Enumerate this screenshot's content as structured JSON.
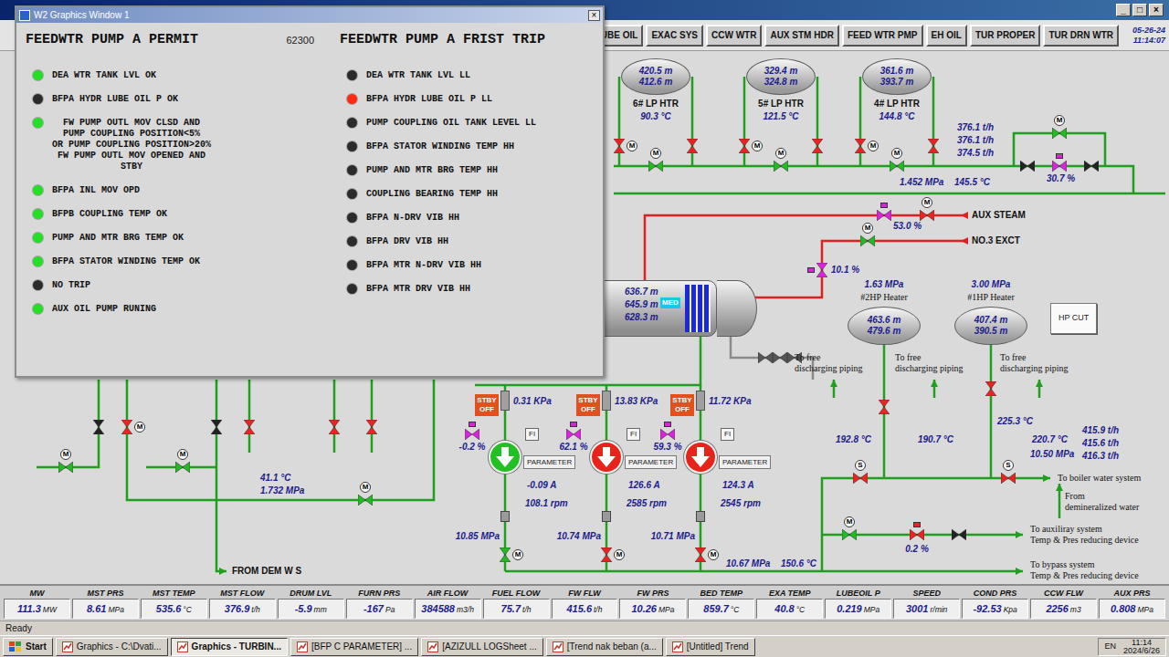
{
  "app_window": {
    "controls": [
      "_",
      "□",
      "×"
    ]
  },
  "tabs": [
    {
      "label": "LUBE OIL"
    },
    {
      "label": "EXAC SYS"
    },
    {
      "label": "CCW WTR"
    },
    {
      "label": "AUX STM HDR"
    },
    {
      "label": "FEED WTR PMP"
    },
    {
      "label": "EH OIL"
    },
    {
      "label": "TUR PROPER"
    },
    {
      "label": "TUR DRN WTR"
    }
  ],
  "clock": {
    "date": "05-26-24",
    "time": "11:14:07"
  },
  "diagram": {
    "symbols": {
      "motor": "M",
      "solenoid": "S"
    },
    "lp_heaters": [
      {
        "name": "6# LP HTR",
        "levels": [
          "420.5 m",
          "412.6 m"
        ],
        "temp": "90.3 °C"
      },
      {
        "name": "5# LP HTR",
        "levels": [
          "329.4 m",
          "324.8 m"
        ],
        "temp": "121.5 °C"
      },
      {
        "name": "4# LP HTR",
        "levels": [
          "361.6 m",
          "393.7 m"
        ],
        "temp": "144.8 °C"
      }
    ],
    "lp_line": {
      "flows": [
        "376.1 t/h",
        "376.1 t/h",
        "374.5 t/h"
      ],
      "pressure": "1.452 MPa",
      "temp": "145.5 °C",
      "bypass_valve": "30.7 %"
    },
    "steam": {
      "aux_label": "AUX STEAM",
      "aux_valve": "53.0 %",
      "exct_label": "NO.3 EXCT",
      "exct_valve": "10.1 %"
    },
    "deaerator": {
      "levels": [
        "636.7 m",
        "645.9 m",
        "628.3 m"
      ],
      "badge": "MED"
    },
    "hp_heaters": [
      {
        "pressure": "1.63 MPa",
        "name": "#2HP Heater",
        "levels": [
          "463.6 m",
          "479.6 m"
        ]
      },
      {
        "pressure": "3.00 MPa",
        "name": "#1HP Heater",
        "levels": [
          "407.4 m",
          "390.5 m"
        ]
      }
    ],
    "hp_cut": "HP CUT",
    "drains": [
      [
        "To free",
        "discharging piping"
      ],
      [
        "To free",
        "discharging piping"
      ],
      [
        "To free",
        "discharging piping"
      ]
    ],
    "hp_drain_temps": [
      "192.8 °C",
      "190.7 °C",
      "225.3 °C"
    ],
    "feedwater": {
      "temp": "220.7 °C",
      "pressure": "10.50 MPa",
      "flows": [
        "415.9 t/h",
        "415.6 t/h",
        "416.3 t/h"
      ],
      "to_boiler": "To boiler water system",
      "demin": [
        "From",
        "demineralized water"
      ],
      "to_aux": [
        "To auxiliray system",
        "Temp & Pres reducing device"
      ],
      "to_bypass": [
        "To bypass system",
        "Temp & Pres reducing device"
      ],
      "valve": "0.2 %"
    },
    "pumps": [
      {
        "standby": [
          "STBY",
          "OFF"
        ],
        "inlet": "0.31 KPa",
        "scoop": "-0.2 %",
        "fi": "FI",
        "parameter": "PARAMETER",
        "current": "-0.09 A",
        "speed": "108.1 rpm",
        "outlet": "10.85 MPa",
        "running": false
      },
      {
        "standby": [
          "STBY",
          "OFF"
        ],
        "inlet": "13.83 KPa",
        "scoop": "62.1 %",
        "fi": "FI",
        "parameter": "PARAMETER",
        "current": "126.6 A",
        "speed": "2585 rpm",
        "outlet": "10.74 MPa",
        "running": true
      },
      {
        "standby": [
          "STBY",
          "OFF"
        ],
        "inlet": "11.72 KPa",
        "scoop": "59.3 %",
        "fi": "FI",
        "parameter": "PARAMETER",
        "current": "124.3 A",
        "speed": "2545 rpm",
        "outlet": "10.71 MPa",
        "running": true
      }
    ],
    "pump_header": {
      "pressure": "10.67 MPa",
      "temp": "150.6 °C"
    },
    "left": {
      "temp": "41.1 °C",
      "pressure": "1.732 MPa",
      "source": "FROM DEM W S"
    },
    "valves": [
      {
        "kind": "motor",
        "color": "#ee2222"
      },
      {
        "kind": "manual",
        "color": "#ee2222"
      },
      {
        "kind": "motor",
        "color": "#22bb22"
      },
      {
        "kind": "motor",
        "color": "#ee2222"
      },
      {
        "kind": "manual",
        "color": "#ee2222"
      },
      {
        "kind": "motor",
        "color": "#22bb22"
      },
      {
        "kind": "motor",
        "color": "#ee2222"
      },
      {
        "kind": "manual",
        "color": "#ee2222"
      },
      {
        "kind": "motor",
        "color": "#22bb22"
      },
      {
        "kind": "motor",
        "color": "#22bb22"
      },
      {
        "kind": "control",
        "color": "#dd22dd"
      },
      {
        "kind": "manual",
        "color": "#222222"
      },
      {
        "kind": "manual",
        "color": "#222222"
      },
      {
        "kind": "control",
        "color": "#dd22dd"
      },
      {
        "kind": "motor",
        "color": "#ee2222"
      },
      {
        "kind": "motor",
        "color": "#22bb22"
      },
      {
        "kind": "control",
        "color": "#dd22dd"
      },
      {
        "kind": "manual",
        "color": "#555555"
      },
      {
        "kind": "manual",
        "color": "#555555"
      },
      {
        "kind": "manual",
        "color": "#555555"
      },
      {
        "kind": "manual",
        "color": "#ee2222"
      },
      {
        "kind": "manual",
        "color": "#ee2222"
      },
      {
        "kind": "solenoid",
        "color": "#ee2222"
      },
      {
        "kind": "solenoid",
        "color": "#ee2222"
      },
      {
        "kind": "motor",
        "color": "#22bb22"
      },
      {
        "kind": "control",
        "color": "#ee2222"
      },
      {
        "kind": "manual",
        "color": "#222222"
      },
      {
        "kind": "control",
        "color": "#dd22dd"
      },
      {
        "kind": "control",
        "color": "#dd22dd"
      },
      {
        "kind": "control",
        "color": "#dd22dd"
      },
      {
        "kind": "motor",
        "color": "#22bb22"
      },
      {
        "kind": "motor",
        "color": "#ee2222"
      },
      {
        "kind": "motor",
        "color": "#ee2222"
      },
      {
        "kind": "manual",
        "color": "#222222"
      },
      {
        "kind": "motor",
        "color": "#ee2222"
      },
      {
        "kind": "manual",
        "color": "#222222"
      },
      {
        "kind": "manual",
        "color": "#ee2222"
      },
      {
        "kind": "manual",
        "color": "#ee2222"
      },
      {
        "kind": "manual",
        "color": "#ee2222"
      },
      {
        "kind": "motor",
        "color": "#22bb22"
      },
      {
        "kind": "motor",
        "color": "#22bb22"
      },
      {
        "kind": "motor",
        "color": "#22bb22"
      }
    ]
  },
  "popup": {
    "title": "W2 Graphics Window 1",
    "close": "×",
    "permit_title": "FEEDWTR PUMP A PERMIT",
    "code": "62300",
    "trip_title": "FEEDWTR PUMP A FRIST TRIP",
    "permits": [
      {
        "lines": [
          "DEA WTR TANK LVL OK"
        ],
        "color": "#22e022"
      },
      {
        "lines": [
          "BFPA HYDR LUBE OIL P OK"
        ],
        "color": "#2b2b2b"
      },
      {
        "lines": [
          "FW PUMP OUTL MOV CLSD AND",
          "PUMP COUPLING POSITION<5%",
          "OR PUMP COUPLING POSITION>20%",
          "FW PUMP OUTL MOV OPENED AND",
          "STBY"
        ],
        "color": "#22e022"
      },
      {
        "lines": [
          "BFPA INL MOV OPD"
        ],
        "color": "#22e022"
      },
      {
        "lines": [
          "BFPB COUPLING TEMP OK"
        ],
        "color": "#22e022"
      },
      {
        "lines": [
          "PUMP AND MTR BRG TEMP OK"
        ],
        "color": "#22e022"
      },
      {
        "lines": [
          "BFPA STATOR WINDING TEMP OK"
        ],
        "color": "#22e022"
      },
      {
        "lines": [
          "NO TRIP"
        ],
        "color": "#2b2b2b"
      },
      {
        "lines": [
          "AUX OIL PUMP RUNING"
        ],
        "color": "#22e022"
      }
    ],
    "trips": [
      {
        "label": "DEA WTR TANK LVL LL",
        "color": "#2b2b2b"
      },
      {
        "label": "BFPA HYDR LUBE OIL P LL",
        "color": "#ff2a10"
      },
      {
        "label": "PUMP COUPLING OIL TANK LEVEL LL",
        "color": "#2b2b2b"
      },
      {
        "label": "BFPA STATOR WINDING TEMP HH",
        "color": "#2b2b2b"
      },
      {
        "label": "PUMP AND MTR BRG TEMP HH",
        "color": "#2b2b2b"
      },
      {
        "label": "COUPLING BEARING TEMP HH",
        "color": "#2b2b2b"
      },
      {
        "label": "BFPA N-DRV VIB HH",
        "color": "#2b2b2b"
      },
      {
        "label": "BFPA DRV VIB HH",
        "color": "#2b2b2b"
      },
      {
        "label": "BFPA MTR N-DRV VIB HH",
        "color": "#2b2b2b"
      },
      {
        "label": "BFPA MTR DRV VIB HH",
        "color": "#2b2b2b"
      }
    ]
  },
  "status_strip": [
    {
      "label": "MW",
      "value": "111.3",
      "unit": "MW"
    },
    {
      "label": "MST PRS",
      "value": "8.61",
      "unit": "MPa"
    },
    {
      "label": "MST TEMP",
      "value": "535.6",
      "unit": "°C"
    },
    {
      "label": "MST FLOW",
      "value": "376.9",
      "unit": "t/h"
    },
    {
      "label": "DRUM LVL",
      "value": "-5.9",
      "unit": "mm"
    },
    {
      "label": "FURN PRS",
      "value": "-167",
      "unit": "Pa"
    },
    {
      "label": "AIR FLOW",
      "value": "384588",
      "unit": "m3/h"
    },
    {
      "label": "FUEL FLOW",
      "value": "75.7",
      "unit": "t/h"
    },
    {
      "label": "FW FLW",
      "value": "415.6",
      "unit": "t/h"
    },
    {
      "label": "FW PRS",
      "value": "10.26",
      "unit": "MPa"
    },
    {
      "label": "BED TEMP",
      "value": "859.7",
      "unit": "°C"
    },
    {
      "label": "EXA TEMP",
      "value": "40.8",
      "unit": "°C"
    },
    {
      "label": "LUBEOIL P",
      "value": "0.219",
      "unit": "MPa"
    },
    {
      "label": "SPEED",
      "value": "3001",
      "unit": "r/min"
    },
    {
      "label": "COND PRS",
      "value": "-92.53",
      "unit": "Kpa"
    },
    {
      "label": "CCW FLW",
      "value": "2256",
      "unit": "m3"
    },
    {
      "label": "AUX PRS",
      "value": "0.808",
      "unit": "MPa"
    }
  ],
  "status_bar": {
    "text": "Ready"
  },
  "taskbar": {
    "start": "Start",
    "items": [
      {
        "label": "Graphics - C:\\Dvati...",
        "selected": false
      },
      {
        "label": "Graphics - TURBIN...",
        "selected": true
      },
      {
        "label": "[BFP C PARAMETER] ...",
        "selected": false
      },
      {
        "label": "[AZIZULL LOGSheet ...",
        "selected": false
      },
      {
        "label": "[Trend nak beban (a...",
        "selected": false
      },
      {
        "label": "[Untitled] Trend",
        "selected": false
      }
    ],
    "tray": {
      "lang": "EN",
      "time": "11:14",
      "date": "2024/6/26"
    }
  }
}
